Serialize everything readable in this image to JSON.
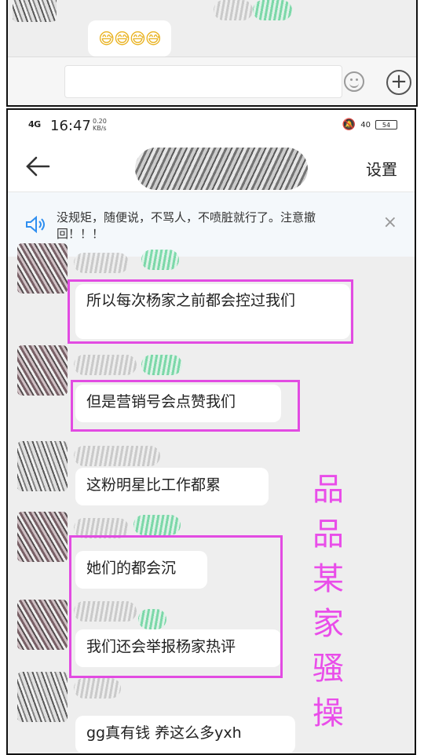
{
  "top_fragment": {
    "emoji_text": "😅😅😅😅"
  },
  "status_bar": {
    "network": "4G",
    "time": "16:47",
    "speed": "0.20\nKB/s",
    "signal_level": "40",
    "battery": "54"
  },
  "nav": {
    "settings_label": "设置"
  },
  "notice": {
    "text": "没规矩，随便说，不骂人，不喷脏就行了。注意撤回！！！",
    "close": "×"
  },
  "messages": [
    {
      "text": "所以每次杨家之前都会控过我们"
    },
    {
      "text": "但是营销号会点赞我们"
    },
    {
      "text": "这粉明星比工作都累"
    },
    {
      "text": "她们的都会沉"
    },
    {
      "text": "我们还会举报杨家热评"
    },
    {
      "text": "gg真有钱 养这么多yxh"
    }
  ],
  "watermark": {
    "chars": [
      "品",
      "品",
      "某",
      "家",
      "骚",
      "操"
    ]
  },
  "colors": {
    "highlight": "#e24be2",
    "watermark": "#e94de9"
  }
}
